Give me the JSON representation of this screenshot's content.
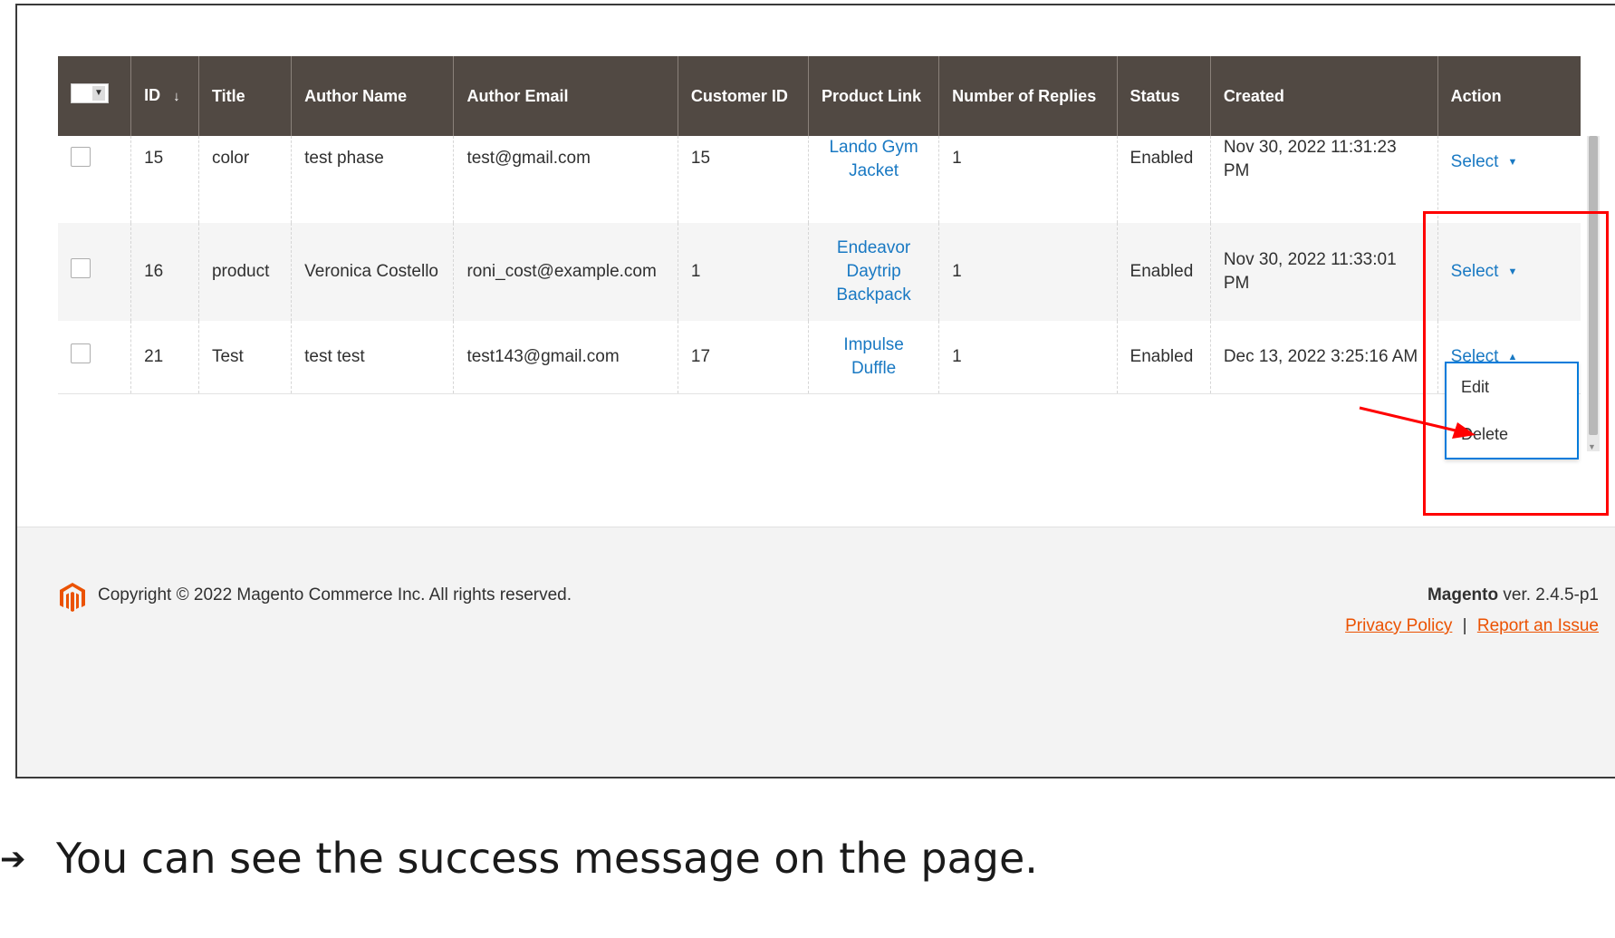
{
  "grid": {
    "columns": [
      {
        "key": "id",
        "label": "ID",
        "sort_icon": "↓"
      },
      {
        "key": "title",
        "label": "Title"
      },
      {
        "key": "author_name",
        "label": "Author Name"
      },
      {
        "key": "author_email",
        "label": "Author Email"
      },
      {
        "key": "customer_id",
        "label": "Customer ID"
      },
      {
        "key": "product_link",
        "label": "Product Link"
      },
      {
        "key": "replies",
        "label": "Number of Replies"
      },
      {
        "key": "status",
        "label": "Status"
      },
      {
        "key": "created",
        "label": "Created"
      },
      {
        "key": "action",
        "label": "Action"
      }
    ],
    "rows": [
      {
        "id": "15",
        "title": "color",
        "author_name": "test phase",
        "author_email": "test@gmail.com",
        "customer_id": "15",
        "product_link": "Lando Gym Jacket",
        "replies": "1",
        "status": "Enabled",
        "created": "Nov 30, 2022 11:31:23 PM",
        "action": "Select",
        "action_icon": "caret-down-icon"
      },
      {
        "id": "16",
        "title": "product",
        "author_name": "Veronica Costello",
        "author_email": "roni_cost@example.com",
        "customer_id": "1",
        "product_link": "Endeavor Daytrip Backpack",
        "replies": "1",
        "status": "Enabled",
        "created": "Nov 30, 2022 11:33:01 PM",
        "action": "Select",
        "action_icon": "caret-down-icon"
      },
      {
        "id": "21",
        "title": "Test",
        "author_name": "test test",
        "author_email": "test143@gmail.com",
        "customer_id": "17",
        "product_link": "Impulse Duffle",
        "replies": "1",
        "status": "Enabled",
        "created": "Dec 13, 2022 3:25:16 AM",
        "action": "Select",
        "action_icon": "caret-up-icon"
      }
    ]
  },
  "action_menu": {
    "items": [
      "Edit",
      "Delete"
    ]
  },
  "footer": {
    "copyright": "Copyright © 2022 Magento Commerce Inc. All rights reserved.",
    "brand": "Magento",
    "version": " ver. 2.4.5-p1",
    "privacy": "Privacy Policy",
    "separator": "|",
    "report": "Report an Issue"
  },
  "caption": {
    "bullet": "➔",
    "text": "You can see the success message on the page."
  },
  "colors": {
    "header_bg": "#514943",
    "link": "#1979c3",
    "footer_link": "#eb5202",
    "highlight": "#ff0000"
  }
}
